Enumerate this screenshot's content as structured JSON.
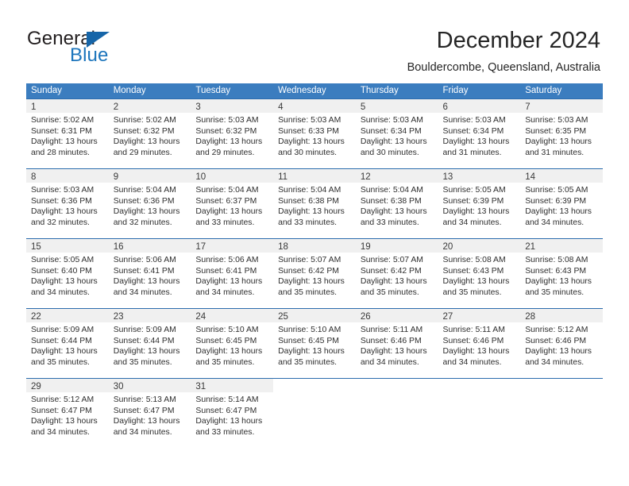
{
  "brand": {
    "name_part1": "General",
    "name_part2": "Blue",
    "triangle_icon": "triangle-logo-icon",
    "accent_color": "#1c75bc"
  },
  "header": {
    "title": "December 2024",
    "location": "Bouldercombe, Queensland, Australia"
  },
  "theme": {
    "header_row_color": "#3b7dbf",
    "week_divider_color": "#2b6cad",
    "daynum_band_color": "#f0f0f0",
    "text_color": "#2e2e2e"
  },
  "weekdays": [
    "Sunday",
    "Monday",
    "Tuesday",
    "Wednesday",
    "Thursday",
    "Friday",
    "Saturday"
  ],
  "weeks": [
    [
      {
        "day": "1",
        "sunrise": "Sunrise: 5:02 AM",
        "sunset": "Sunset: 6:31 PM",
        "daylight_line1": "Daylight: 13 hours",
        "daylight_line2": "and 28 minutes."
      },
      {
        "day": "2",
        "sunrise": "Sunrise: 5:02 AM",
        "sunset": "Sunset: 6:32 PM",
        "daylight_line1": "Daylight: 13 hours",
        "daylight_line2": "and 29 minutes."
      },
      {
        "day": "3",
        "sunrise": "Sunrise: 5:03 AM",
        "sunset": "Sunset: 6:32 PM",
        "daylight_line1": "Daylight: 13 hours",
        "daylight_line2": "and 29 minutes."
      },
      {
        "day": "4",
        "sunrise": "Sunrise: 5:03 AM",
        "sunset": "Sunset: 6:33 PM",
        "daylight_line1": "Daylight: 13 hours",
        "daylight_line2": "and 30 minutes."
      },
      {
        "day": "5",
        "sunrise": "Sunrise: 5:03 AM",
        "sunset": "Sunset: 6:34 PM",
        "daylight_line1": "Daylight: 13 hours",
        "daylight_line2": "and 30 minutes."
      },
      {
        "day": "6",
        "sunrise": "Sunrise: 5:03 AM",
        "sunset": "Sunset: 6:34 PM",
        "daylight_line1": "Daylight: 13 hours",
        "daylight_line2": "and 31 minutes."
      },
      {
        "day": "7",
        "sunrise": "Sunrise: 5:03 AM",
        "sunset": "Sunset: 6:35 PM",
        "daylight_line1": "Daylight: 13 hours",
        "daylight_line2": "and 31 minutes."
      }
    ],
    [
      {
        "day": "8",
        "sunrise": "Sunrise: 5:03 AM",
        "sunset": "Sunset: 6:36 PM",
        "daylight_line1": "Daylight: 13 hours",
        "daylight_line2": "and 32 minutes."
      },
      {
        "day": "9",
        "sunrise": "Sunrise: 5:04 AM",
        "sunset": "Sunset: 6:36 PM",
        "daylight_line1": "Daylight: 13 hours",
        "daylight_line2": "and 32 minutes."
      },
      {
        "day": "10",
        "sunrise": "Sunrise: 5:04 AM",
        "sunset": "Sunset: 6:37 PM",
        "daylight_line1": "Daylight: 13 hours",
        "daylight_line2": "and 33 minutes."
      },
      {
        "day": "11",
        "sunrise": "Sunrise: 5:04 AM",
        "sunset": "Sunset: 6:38 PM",
        "daylight_line1": "Daylight: 13 hours",
        "daylight_line2": "and 33 minutes."
      },
      {
        "day": "12",
        "sunrise": "Sunrise: 5:04 AM",
        "sunset": "Sunset: 6:38 PM",
        "daylight_line1": "Daylight: 13 hours",
        "daylight_line2": "and 33 minutes."
      },
      {
        "day": "13",
        "sunrise": "Sunrise: 5:05 AM",
        "sunset": "Sunset: 6:39 PM",
        "daylight_line1": "Daylight: 13 hours",
        "daylight_line2": "and 34 minutes."
      },
      {
        "day": "14",
        "sunrise": "Sunrise: 5:05 AM",
        "sunset": "Sunset: 6:39 PM",
        "daylight_line1": "Daylight: 13 hours",
        "daylight_line2": "and 34 minutes."
      }
    ],
    [
      {
        "day": "15",
        "sunrise": "Sunrise: 5:05 AM",
        "sunset": "Sunset: 6:40 PM",
        "daylight_line1": "Daylight: 13 hours",
        "daylight_line2": "and 34 minutes."
      },
      {
        "day": "16",
        "sunrise": "Sunrise: 5:06 AM",
        "sunset": "Sunset: 6:41 PM",
        "daylight_line1": "Daylight: 13 hours",
        "daylight_line2": "and 34 minutes."
      },
      {
        "day": "17",
        "sunrise": "Sunrise: 5:06 AM",
        "sunset": "Sunset: 6:41 PM",
        "daylight_line1": "Daylight: 13 hours",
        "daylight_line2": "and 34 minutes."
      },
      {
        "day": "18",
        "sunrise": "Sunrise: 5:07 AM",
        "sunset": "Sunset: 6:42 PM",
        "daylight_line1": "Daylight: 13 hours",
        "daylight_line2": "and 35 minutes."
      },
      {
        "day": "19",
        "sunrise": "Sunrise: 5:07 AM",
        "sunset": "Sunset: 6:42 PM",
        "daylight_line1": "Daylight: 13 hours",
        "daylight_line2": "and 35 minutes."
      },
      {
        "day": "20",
        "sunrise": "Sunrise: 5:08 AM",
        "sunset": "Sunset: 6:43 PM",
        "daylight_line1": "Daylight: 13 hours",
        "daylight_line2": "and 35 minutes."
      },
      {
        "day": "21",
        "sunrise": "Sunrise: 5:08 AM",
        "sunset": "Sunset: 6:43 PM",
        "daylight_line1": "Daylight: 13 hours",
        "daylight_line2": "and 35 minutes."
      }
    ],
    [
      {
        "day": "22",
        "sunrise": "Sunrise: 5:09 AM",
        "sunset": "Sunset: 6:44 PM",
        "daylight_line1": "Daylight: 13 hours",
        "daylight_line2": "and 35 minutes."
      },
      {
        "day": "23",
        "sunrise": "Sunrise: 5:09 AM",
        "sunset": "Sunset: 6:44 PM",
        "daylight_line1": "Daylight: 13 hours",
        "daylight_line2": "and 35 minutes."
      },
      {
        "day": "24",
        "sunrise": "Sunrise: 5:10 AM",
        "sunset": "Sunset: 6:45 PM",
        "daylight_line1": "Daylight: 13 hours",
        "daylight_line2": "and 35 minutes."
      },
      {
        "day": "25",
        "sunrise": "Sunrise: 5:10 AM",
        "sunset": "Sunset: 6:45 PM",
        "daylight_line1": "Daylight: 13 hours",
        "daylight_line2": "and 35 minutes."
      },
      {
        "day": "26",
        "sunrise": "Sunrise: 5:11 AM",
        "sunset": "Sunset: 6:46 PM",
        "daylight_line1": "Daylight: 13 hours",
        "daylight_line2": "and 34 minutes."
      },
      {
        "day": "27",
        "sunrise": "Sunrise: 5:11 AM",
        "sunset": "Sunset: 6:46 PM",
        "daylight_line1": "Daylight: 13 hours",
        "daylight_line2": "and 34 minutes."
      },
      {
        "day": "28",
        "sunrise": "Sunrise: 5:12 AM",
        "sunset": "Sunset: 6:46 PM",
        "daylight_line1": "Daylight: 13 hours",
        "daylight_line2": "and 34 minutes."
      }
    ],
    [
      {
        "day": "29",
        "sunrise": "Sunrise: 5:12 AM",
        "sunset": "Sunset: 6:47 PM",
        "daylight_line1": "Daylight: 13 hours",
        "daylight_line2": "and 34 minutes."
      },
      {
        "day": "30",
        "sunrise": "Sunrise: 5:13 AM",
        "sunset": "Sunset: 6:47 PM",
        "daylight_line1": "Daylight: 13 hours",
        "daylight_line2": "and 34 minutes."
      },
      {
        "day": "31",
        "sunrise": "Sunrise: 5:14 AM",
        "sunset": "Sunset: 6:47 PM",
        "daylight_line1": "Daylight: 13 hours",
        "daylight_line2": "and 33 minutes."
      },
      {
        "day": "",
        "sunrise": "",
        "sunset": "",
        "daylight_line1": "",
        "daylight_line2": ""
      },
      {
        "day": "",
        "sunrise": "",
        "sunset": "",
        "daylight_line1": "",
        "daylight_line2": ""
      },
      {
        "day": "",
        "sunrise": "",
        "sunset": "",
        "daylight_line1": "",
        "daylight_line2": ""
      },
      {
        "day": "",
        "sunrise": "",
        "sunset": "",
        "daylight_line1": "",
        "daylight_line2": ""
      }
    ]
  ]
}
